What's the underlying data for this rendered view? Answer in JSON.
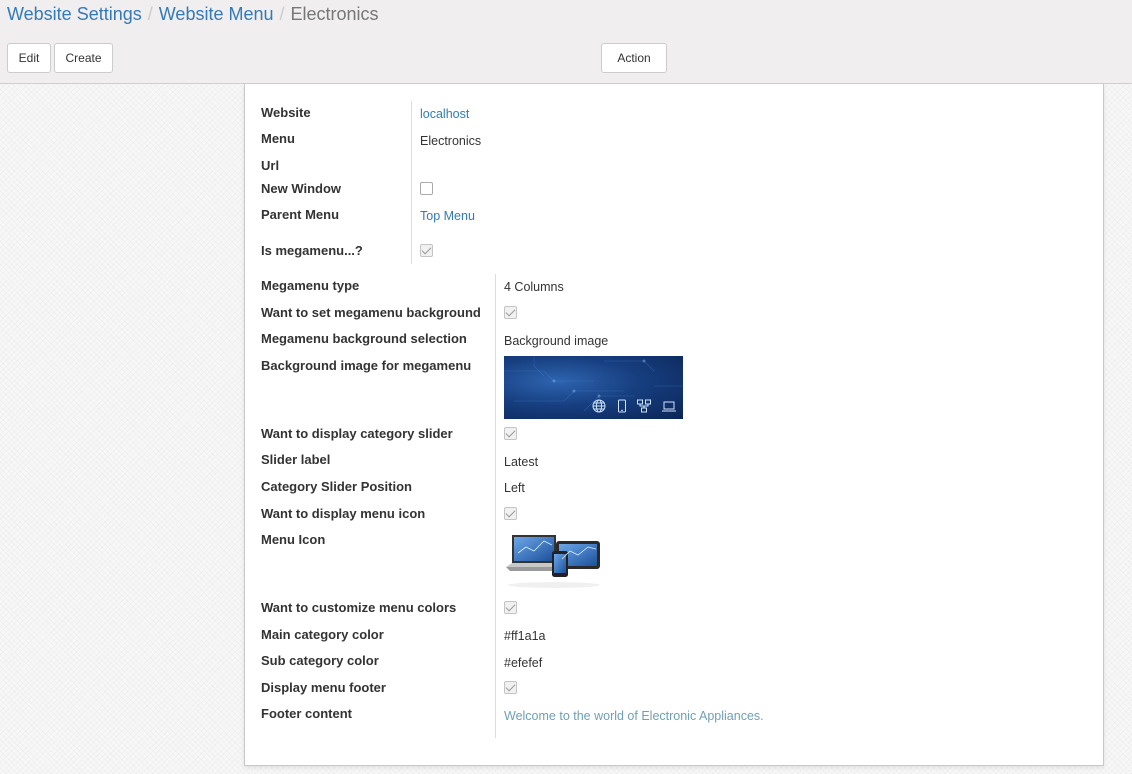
{
  "breadcrumb": {
    "items": [
      "Website Settings",
      "Website Menu"
    ],
    "separator": "/",
    "current": "Electronics"
  },
  "buttons": {
    "edit": "Edit",
    "create": "Create",
    "action": "Action"
  },
  "form": {
    "website": {
      "label": "Website",
      "value": "localhost"
    },
    "menu": {
      "label": "Menu",
      "value": "Electronics"
    },
    "url": {
      "label": "Url",
      "value": ""
    },
    "new_window": {
      "label": "New Window",
      "checked": false
    },
    "parent_menu": {
      "label": "Parent Menu",
      "value": "Top Menu"
    },
    "is_megamenu": {
      "label": "Is megamenu...?",
      "checked": true
    },
    "megamenu_type": {
      "label": "Megamenu type",
      "value": "4 Columns"
    },
    "set_megamenu_bg": {
      "label": "Want to set megamenu background",
      "checked": true
    },
    "megamenu_bg_selection": {
      "label": "Megamenu background selection",
      "value": "Background image"
    },
    "bg_image": {
      "label": "Background image for megamenu",
      "icons": [
        "globe-icon",
        "mobile-phone-icon",
        "network-icon",
        "laptop-icon"
      ]
    },
    "display_category_slider": {
      "label": "Want to display category slider",
      "checked": true
    },
    "slider_label": {
      "label": "Slider label",
      "value": "Latest"
    },
    "category_slider_position": {
      "label": "Category Slider Position",
      "value": "Left"
    },
    "display_menu_icon": {
      "label": "Want to display menu icon",
      "checked": true
    },
    "menu_icon": {
      "label": "Menu Icon",
      "image": "devices-image"
    },
    "customize_menu_colors": {
      "label": "Want to customize menu colors",
      "checked": true
    },
    "main_category_color": {
      "label": "Main category color",
      "value": "#ff1a1a"
    },
    "sub_category_color": {
      "label": "Sub category color",
      "value": "#efefef"
    },
    "display_menu_footer": {
      "label": "Display menu footer",
      "checked": true
    },
    "footer_content": {
      "label": "Footer content",
      "value": "Welcome to the world of Electronic Appliances."
    }
  },
  "colors": {
    "link": "#337ab7",
    "footer_text": "#6f9fb5",
    "panel_bg": "#f0eeee"
  }
}
